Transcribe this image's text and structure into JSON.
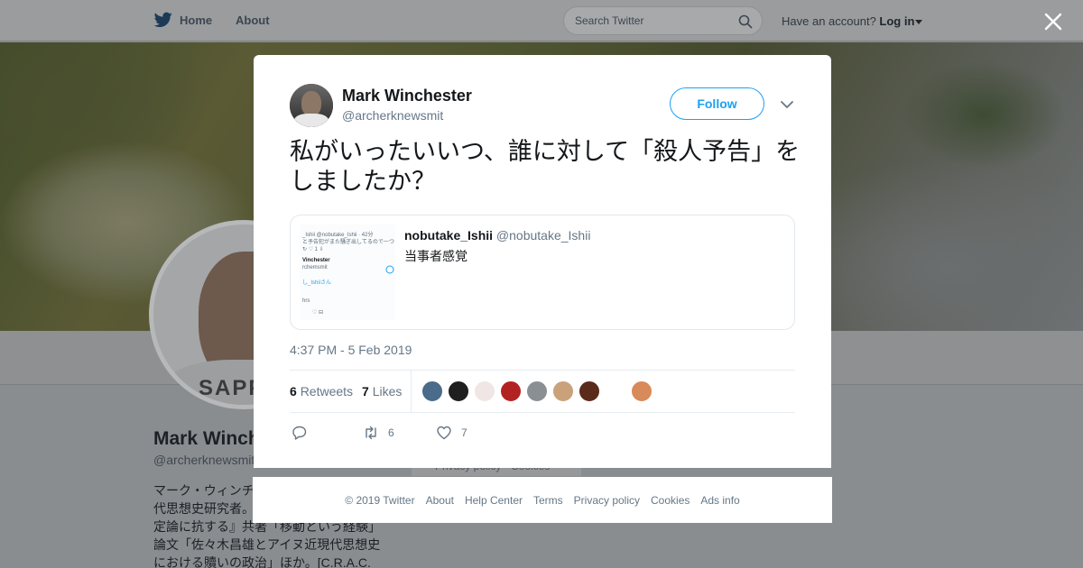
{
  "topbar": {
    "home_label": "Home",
    "about_label": "About",
    "search_placeholder": "Search Twitter",
    "account_prompt": "Have an account?",
    "login_label": "Log in"
  },
  "profile": {
    "name": "Mark Winch",
    "handle": "@archerknewsmit",
    "bio_lines": [
      "マーク・ウィンチ",
      "代思想史研究者。",
      "定論に抗する』共著「移動という経験」",
      "論文「佐々木昌雄とアイヌ近現代思想史",
      "における贖いの政治」ほか。[C.R.A.C."
    ],
    "bg_legal": "Privacy policy · Cookies"
  },
  "tweet": {
    "author_name": "Mark Winchester",
    "author_handle": "@archerknewsmit",
    "follow_label": "Follow",
    "text": "私がいったいいつ、誰に対して「殺人予告」をしましたか？",
    "timestamp": "4:37 PM - 5 Feb 2019",
    "retweet_count": "6",
    "retweet_label": "Retweets",
    "like_count": "7",
    "like_label": "Likes",
    "action_retweet_count": "6",
    "action_like_count": "7",
    "liker_colors": [
      "#4a6b8a",
      "#1f1f1f",
      "#f0e6e6",
      "#b32222",
      "#8a8f94",
      "#c9a27a",
      "#5a2a1a",
      "#d88a5a"
    ],
    "quote": {
      "name": "nobutake_Ishii",
      "handle": "@nobutake_Ishii",
      "text": "当事者感覚",
      "thumb_lines": [
        "_Ishii @nobutake_Ishii · 42分",
        "と予告犯がまた騒ぎ出してるので一つしょうか。",
        "↻        ♡ 1        ⇩",
        "Vinchester",
        "rchemsmit",
        "し_Ishiiさん",
        "hrs",
        "♡        ⊟"
      ]
    }
  },
  "footer": {
    "copyright": "© 2019 Twitter",
    "links": [
      "About",
      "Help Center",
      "Terms",
      "Privacy policy",
      "Cookies",
      "Ads info"
    ]
  },
  "colors": {
    "accent": "#1da1f2",
    "secondary_text": "#657786"
  }
}
